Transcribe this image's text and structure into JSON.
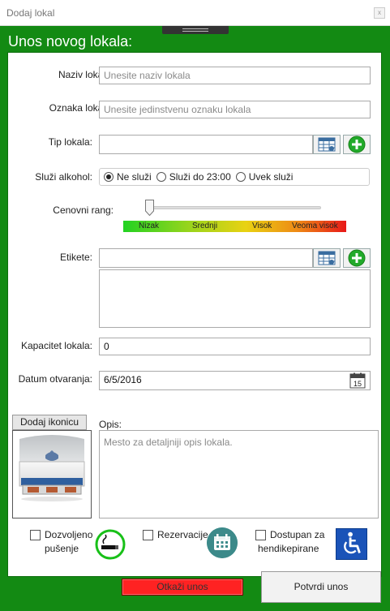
{
  "window": {
    "title": "Dodaj lokal",
    "close_glyph": "x"
  },
  "heading": "Unos novog lokala:",
  "form": {
    "name_label": "Naziv lokala:",
    "name_placeholder": "Unesite naziv lokala",
    "code_label": "Oznaka lokala:",
    "code_placeholder": "Unesite jedinstvenu oznaku lokala",
    "type_label": "Tip lokala:",
    "type_value": "",
    "alcohol_label": "Služi alkohol:",
    "alcohol_options": [
      "Ne služi",
      "Služi do 23:00",
      "Uvek služi"
    ],
    "alcohol_selected": "Ne služi",
    "price_label": "Cenovni rang:",
    "price_level": 0,
    "price_scale": [
      "Nizak",
      "Srednji",
      "Visok",
      "Veoma visok"
    ],
    "tags_label": "Etikete:",
    "tags_value": "",
    "capacity_label": "Kapacitet lokala:",
    "capacity_value": "0",
    "date_label": "Datum otvaranja:",
    "date_value": "6/5/2016",
    "calendar_day": "15",
    "add_icon_button": "Dodaj ikonicu",
    "description_label": "Opis:",
    "description_placeholder": "Mesto za detaljniji opis lokala.",
    "smoking": {
      "label_line1": "Dozvoljeno",
      "label_line2": "pušenje",
      "checked": false
    },
    "reservation": {
      "label": "Rezervacije",
      "checked": false
    },
    "accessible": {
      "label_line1": "Dostupan za",
      "label_line2": "hendikepirane",
      "checked": false
    }
  },
  "actions": {
    "cancel": "Otkaži unos",
    "confirm": "Potvrdi unos"
  },
  "colors": {
    "frame": "#138a13",
    "cancel": "#ff2222",
    "accessible_icon": "#1a53b8",
    "reservation_icon": "#3c8a8a"
  },
  "icons": [
    "table-icon",
    "add-icon",
    "calendar-icon",
    "no-smoking-icon",
    "calendar-reservation-icon",
    "wheelchair-icon"
  ]
}
